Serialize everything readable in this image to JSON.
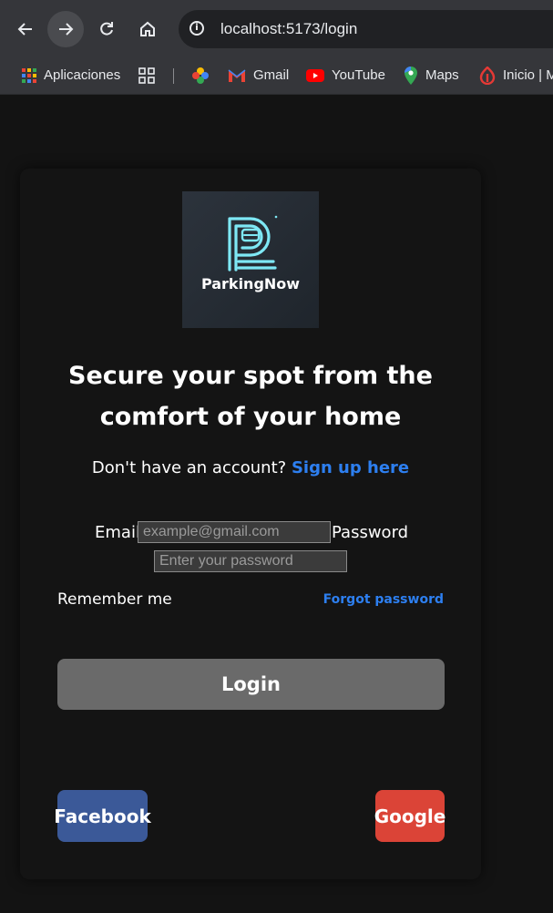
{
  "browser": {
    "url": "localhost:5173/login",
    "bookmarks": [
      {
        "label": "Aplicaciones",
        "icon": "apps-icon"
      },
      {
        "label": "",
        "icon": "tab-groups-icon"
      },
      {
        "label": "",
        "icon": "google-photos-icon"
      },
      {
        "label": "Gmail",
        "icon": "gmail-icon"
      },
      {
        "label": "YouTube",
        "icon": "youtube-icon"
      },
      {
        "label": "Maps",
        "icon": "maps-icon"
      },
      {
        "label": "Inicio | M",
        "icon": "inicio-icon"
      }
    ]
  },
  "page": {
    "logo_text": "ParkingNow",
    "headline": "Secure your spot from the comfort of your home",
    "signup_prompt": "Don't have an account?",
    "signup_link": "Sign up here",
    "email_label": "Email",
    "email_placeholder": "example@gmail.com",
    "password_label": "Password",
    "password_placeholder": "Enter your password",
    "remember_label": "Remember me",
    "forgot_label": "Forgot password",
    "login_label": "Login",
    "facebook_label": "Facebook",
    "google_label": "Google"
  },
  "colors": {
    "accent_link": "#2d7ff0",
    "facebook": "#3b5998",
    "google": "#db4437",
    "login_button": "#6a6a6a",
    "logo_cyan": "#7ee8f5"
  }
}
